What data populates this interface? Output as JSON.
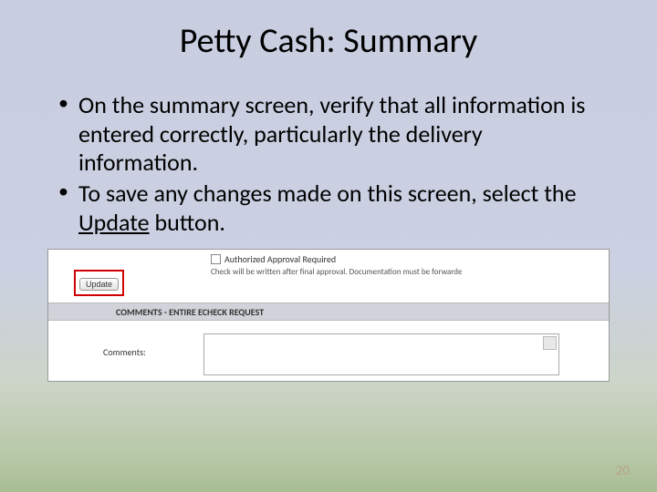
{
  "title": "Petty Cash: Summary",
  "bullets": [
    {
      "pre": "On the summary screen, verify that all information is entered correctly, particularly the delivery information."
    },
    {
      "pre": "To save any changes made on this screen, select the ",
      "u": "Update",
      "post": " button."
    }
  ],
  "screenshot": {
    "approval_label": "Authorized Approval Required",
    "disclaimer": "Check will be written after final approval. Documentation must be forwarde",
    "update_btn": "Update",
    "section_header": "COMMENTS - ENTIRE ECHECK REQUEST",
    "comments_label": "Comments:"
  },
  "page_number": "20"
}
